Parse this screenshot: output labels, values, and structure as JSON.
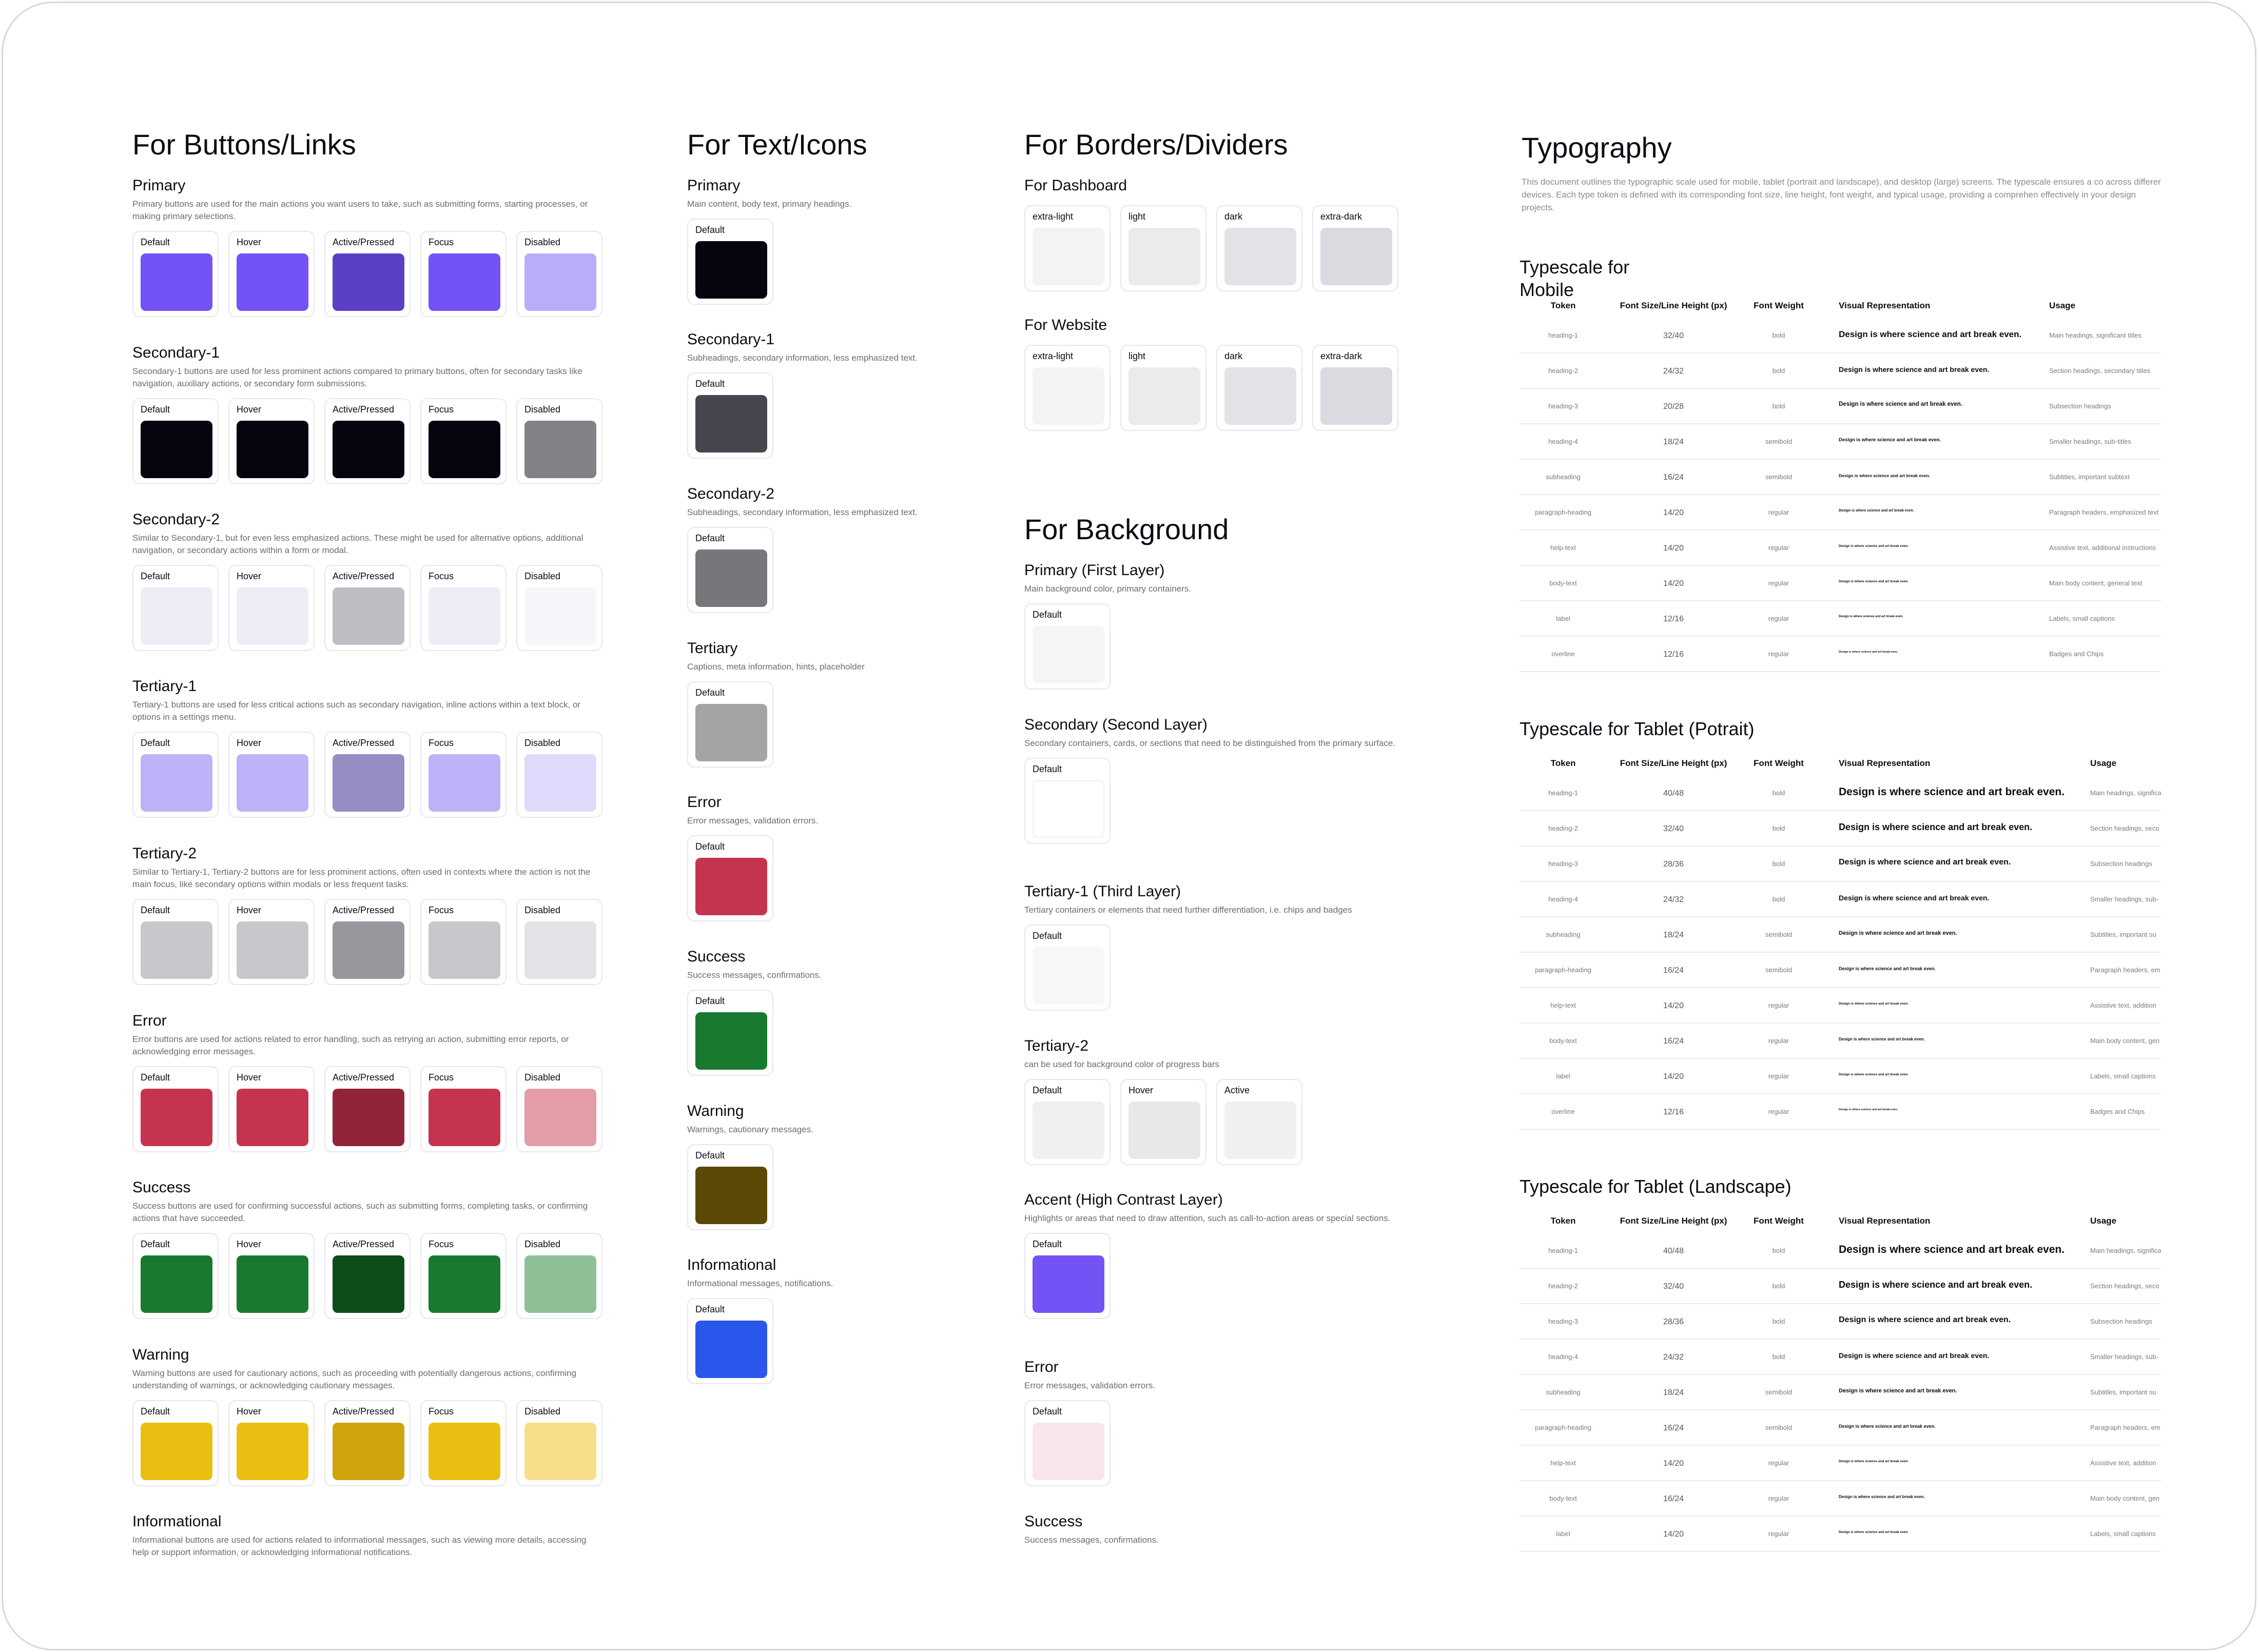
{
  "buttons": {
    "title": "For Buttons/Links",
    "groups": [
      {
        "name": "Primary",
        "desc": "Primary buttons are used for the main actions you want users to take, such as submitting forms, starting processes, or making primary selections.",
        "colors": [
          "#7352f6",
          "#7352f6",
          "#5b40c6",
          "#7352f6",
          "#b9acfa"
        ]
      },
      {
        "name": "Secondary-1",
        "desc": "Secondary-1 buttons are used for less prominent actions compared to primary buttons, often for secondary tasks like navigation, auxiliary actions, or secondary form submissions.",
        "colors": [
          "#06040e",
          "#06040e",
          "#06040e",
          "#06040e",
          "#828188"
        ]
      },
      {
        "name": "Secondary-2",
        "desc": "Similar to Secondary-1, but for even less emphasized actions. These might be used for alternative options, additional navigation, or secondary actions within a form or modal.",
        "colors": [
          "#eeedf5",
          "#eeedf5",
          "#bebdc3",
          "#eeedf5",
          "#f6f6fa"
        ]
      },
      {
        "name": "Tertiary-1",
        "desc": "Tertiary-1 buttons are used for less critical actions such as secondary navigation, inline actions within a text block, or options in a settings menu.",
        "colors": [
          "#bcb3f8",
          "#bcb3f8",
          "#958dc4",
          "#bcb3f8",
          "#dedbfc"
        ]
      },
      {
        "name": "Tertiary-2",
        "desc": "Similar to Tertiary-1, Tertiary-2 buttons are for less prominent actions, often used in contexts where the action is not the main focus, like secondary options within modals or less frequent tasks.",
        "colors": [
          "#c8c7cc",
          "#c8c7cc",
          "#99979d",
          "#c8c7cc",
          "#e4e3e7"
        ]
      },
      {
        "name": "Error",
        "desc": "Error buttons are used for actions related to error handling, such as retrying an action, submitting error reports, or acknowledging error messages.",
        "colors": [
          "#c5344f",
          "#c5344f",
          "#92243a",
          "#c5344f",
          "#e49ca8"
        ]
      },
      {
        "name": "Success",
        "desc": "Success buttons are used for confirming successful actions, such as submitting forms, completing tasks, or confirming actions that have succeeded.",
        "colors": [
          "#187a2f",
          "#187a2f",
          "#0d4d1b",
          "#187a2f",
          "#8dc097"
        ]
      },
      {
        "name": "Warning",
        "desc": "Warning buttons are used for cautionary actions, such as proceeding with potentially dangerous actions, confirming understanding of warnings, or acknowledging cautionary messages.",
        "colors": [
          "#ebbf12",
          "#ebbf12",
          "#cfa50f",
          "#ebbf12",
          "#f6df88"
        ]
      },
      {
        "name": "Informational",
        "desc": "Informational buttons are used for actions related to informational messages, such as viewing more details, accessing help or support information, or acknowledging informational notifications.",
        "colors": []
      }
    ],
    "states": [
      "Default",
      "Hover",
      "Active/Pressed",
      "Focus",
      "Disabled"
    ]
  },
  "text_icons": {
    "title": "For Text/Icons",
    "default_label": "Default",
    "groups": [
      {
        "name": "Primary",
        "desc": "Main content, body text, primary headings.",
        "color": "#06040e"
      },
      {
        "name": "Secondary-1",
        "desc": "Subheadings, secondary information, less emphasized text.",
        "color": "#47454d"
      },
      {
        "name": "Secondary-2",
        "desc": "Subheadings, secondary information, less emphasized text.",
        "color": "#77767b"
      },
      {
        "name": "Tertiary",
        "desc": "Captions, meta information, hints, placeholder",
        "color": "#a4a4a6"
      },
      {
        "name": "Error",
        "desc": "Error messages, validation errors.",
        "color": "#c5344f"
      },
      {
        "name": "Success",
        "desc": "Success messages, confirmations.",
        "color": "#187a2f"
      },
      {
        "name": "Warning",
        "desc": "Warnings, cautionary messages.",
        "color": "#5c4907"
      },
      {
        "name": "Informational",
        "desc": "Informational messages, notifications.",
        "color": "#2a56eb"
      }
    ]
  },
  "borders": {
    "title": "For Borders/Dividers",
    "groups": [
      {
        "name": "For Dashboard",
        "items": [
          {
            "label": "extra-light",
            "color": "#f3f3f5"
          },
          {
            "label": "light",
            "color": "#ebebee"
          },
          {
            "label": "dark",
            "color": "#e3e3e7"
          },
          {
            "label": "extra-dark",
            "color": "#dadae1"
          }
        ]
      },
      {
        "name": "For Website",
        "items": [
          {
            "label": "extra-light",
            "color": "#f3f3f5"
          },
          {
            "label": "light",
            "color": "#ebebee"
          },
          {
            "label": "dark",
            "color": "#e3e3e7"
          },
          {
            "label": "extra-dark",
            "color": "#dadae1"
          }
        ]
      }
    ]
  },
  "background": {
    "title": "For Background",
    "groups": [
      {
        "name": "Primary (First Layer)",
        "desc": "Main background color, primary containers.",
        "items": [
          {
            "label": "Default",
            "color": "#f5f5f6"
          }
        ]
      },
      {
        "name": "Secondary (Second Layer)",
        "desc": "Secondary containers, cards, or sections that need to be distinguished from the primary surface.",
        "items": [
          {
            "label": "Default",
            "color": "#ffffff"
          }
        ]
      },
      {
        "name": "Tertiary-1 (Third Layer)",
        "desc": "Tertiary containers or elements that need further differentiation, i.e. chips and badges",
        "items": [
          {
            "label": "Default",
            "color": "#f7f7f8"
          }
        ]
      },
      {
        "name": "Tertiary-2",
        "desc": "can be used for background color of progress bars",
        "items": [
          {
            "label": "Default",
            "color": "#f0f0f2"
          },
          {
            "label": "Hover",
            "color": "#e8e8ea"
          },
          {
            "label": "Active",
            "color": "#f0f0f2"
          }
        ]
      },
      {
        "name": "Accent (High Contrast Layer)",
        "desc": "Highlights or areas that need to draw attention, such as call-to-action areas or special sections.",
        "items": [
          {
            "label": "Default",
            "color": "#7352f6"
          }
        ]
      },
      {
        "name": "Error",
        "desc": "Error messages, validation errors.",
        "items": [
          {
            "label": "Default",
            "color": "#f9e6ea"
          }
        ]
      },
      {
        "name": "Success",
        "desc": "Success messages, confirmations.",
        "items": []
      }
    ]
  },
  "typography": {
    "title": "Typography",
    "intro": "This document outlines the typographic scale used for mobile, tablet (portrait and landscape), and desktop (large) screens. The typescale ensures a co across different devices. Each type token is defined with its corresponding font size, line height, font weight, and typical usage, providing a comprehen effectively in your design projects.",
    "headers": {
      "token": "Token",
      "size": "Font Size/Line Height (px)",
      "weight": "Font Weight",
      "visual": "Visual Representation",
      "usage": "Usage"
    },
    "sample": "Design is where science and art break even.",
    "tables": [
      {
        "title": "Typescale for Mobile",
        "rows": [
          {
            "token": "heading-1",
            "size": "32/40",
            "weight": "bold",
            "usage": "Main headings, significant titles"
          },
          {
            "token": "heading-2",
            "size": "24/32",
            "weight": "bold",
            "usage": "Section headings, secondary titles"
          },
          {
            "token": "heading-3",
            "size": "20/28",
            "weight": "bold",
            "usage": "Subsection headings"
          },
          {
            "token": "heading-4",
            "size": "18/24",
            "weight": "semibold",
            "usage": "Smaller headings, sub-titles"
          },
          {
            "token": "subheading",
            "size": "16/24",
            "weight": "semibold",
            "usage": "Subtitles, important subtext"
          },
          {
            "token": "paragraph-heading",
            "size": "14/20",
            "weight": "regular",
            "usage": "Paragraph headers, emphasized text"
          },
          {
            "token": "help-text",
            "size": "14/20",
            "weight": "regular",
            "usage": "Assistive text, additional instructions"
          },
          {
            "token": "body-text",
            "size": "14/20",
            "weight": "regular",
            "usage": "Main body content, general text"
          },
          {
            "token": "label",
            "size": "12/16",
            "weight": "regular",
            "usage": "Labels, small captions"
          },
          {
            "token": "overline",
            "size": "12/16",
            "weight": "regular",
            "usage": "Badges and Chips"
          }
        ]
      },
      {
        "title": "Typescale for Tablet (Potrait)",
        "rows": [
          {
            "token": "heading-1",
            "size": "40/48",
            "weight": "bold",
            "usage": "Main headings, significa"
          },
          {
            "token": "heading-2",
            "size": "32/40",
            "weight": "bold",
            "usage": "Section headings, seco"
          },
          {
            "token": "heading-3",
            "size": "28/36",
            "weight": "bold",
            "usage": "Subsection headings"
          },
          {
            "token": "heading-4",
            "size": "24/32",
            "weight": "bold",
            "usage": "Smaller headings, sub-"
          },
          {
            "token": "subheading",
            "size": "18/24",
            "weight": "semibold",
            "usage": "Subtitles, important su"
          },
          {
            "token": "paragraph-heading",
            "size": "16/24",
            "weight": "semibold",
            "usage": "Paragraph headers, em"
          },
          {
            "token": "help-text",
            "size": "14/20",
            "weight": "regular",
            "usage": "Assistive text, addition"
          },
          {
            "token": "body-text",
            "size": "16/24",
            "weight": "regular",
            "usage": "Main body content, gen"
          },
          {
            "token": "label",
            "size": "14/20",
            "weight": "regular",
            "usage": "Labels, small captions"
          },
          {
            "token": "overline",
            "size": "12/16",
            "weight": "regular",
            "usage": "Badges and Chips"
          }
        ]
      },
      {
        "title": "Typescale for Tablet (Landscape)",
        "rows": [
          {
            "token": "heading-1",
            "size": "40/48",
            "weight": "bold",
            "usage": "Main headings, significa"
          },
          {
            "token": "heading-2",
            "size": "32/40",
            "weight": "bold",
            "usage": "Section headings, seco"
          },
          {
            "token": "heading-3",
            "size": "28/36",
            "weight": "bold",
            "usage": "Subsection headings"
          },
          {
            "token": "heading-4",
            "size": "24/32",
            "weight": "bold",
            "usage": "Smaller headings, sub-"
          },
          {
            "token": "subheading",
            "size": "18/24",
            "weight": "semibold",
            "usage": "Subtitles, important su"
          },
          {
            "token": "paragraph-heading",
            "size": "16/24",
            "weight": "semibold",
            "usage": "Paragraph headers, em"
          },
          {
            "token": "help-text",
            "size": "14/20",
            "weight": "regular",
            "usage": "Assistive text, addition"
          },
          {
            "token": "body-text",
            "size": "16/24",
            "weight": "regular",
            "usage": "Main body content, gen"
          },
          {
            "token": "label",
            "size": "14/20",
            "weight": "regular",
            "usage": "Labels, small captions"
          }
        ]
      }
    ]
  }
}
